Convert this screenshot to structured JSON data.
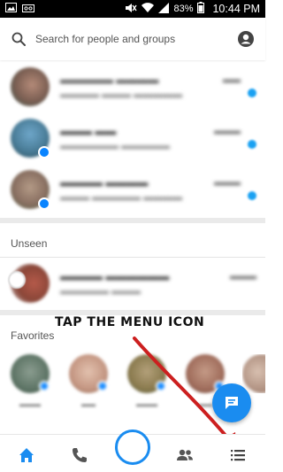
{
  "status_bar": {
    "battery": "83%",
    "time": "10:44 PM"
  },
  "search": {
    "placeholder": "Search for people and groups"
  },
  "sections": {
    "unseen": "Unseen",
    "favorites": "Favorites"
  },
  "annotation": {
    "text": "TAP THE MENU ICON"
  },
  "colors": {
    "accent": "#1a8cf0",
    "annotation_arrow": "#cc1f1f"
  },
  "icons": {
    "search": "search-icon",
    "profile": "profile-icon",
    "compose": "chat-bubble-icon",
    "home": "home-icon",
    "calls": "phone-icon",
    "people": "people-icon",
    "menu": "menu-list-icon"
  }
}
